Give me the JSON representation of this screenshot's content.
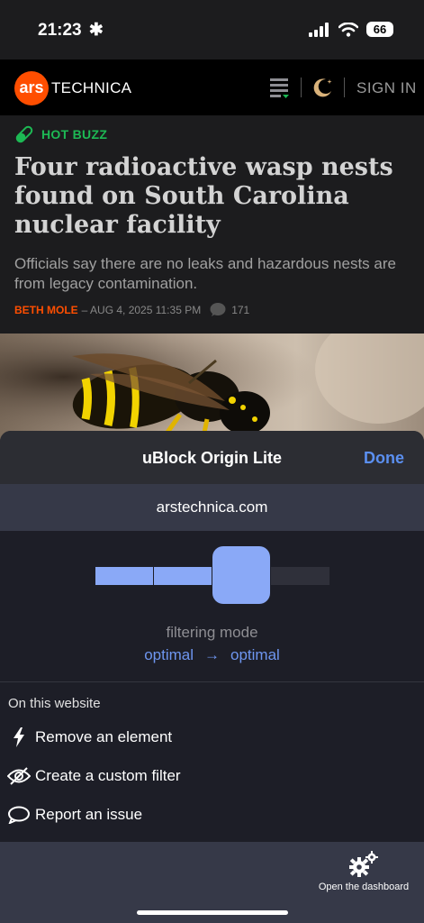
{
  "status": {
    "time": "21:23",
    "battery": "66"
  },
  "header": {
    "logo_short": "ars",
    "logo_word": "TECHNICA",
    "signin": "SIGN IN"
  },
  "article": {
    "category": "HOT BUZZ",
    "headline": "Four radioactive wasp nests found on South Carolina nuclear facility",
    "subtitle": "Officials say there are no leaks and hazardous nests are from legacy contamination.",
    "author": "BETH MOLE",
    "date": "– AUG 4, 2025 11:35 PM",
    "comments": "171"
  },
  "ublock": {
    "title": "uBlock Origin Lite",
    "done": "Done",
    "hostname": "arstechnica.com",
    "filtering_level": 3,
    "filtering_levels": 4,
    "filtering_mode_label": "filtering mode",
    "mode_from": "optimal",
    "mode_arrow": "→",
    "mode_to": "optimal",
    "section_label": "On this website",
    "actions": [
      {
        "label": "Remove an element",
        "icon": "bolt-icon"
      },
      {
        "label": "Create a custom filter",
        "icon": "eye-slash-icon"
      },
      {
        "label": "Report an issue",
        "icon": "speech-bubble-icon"
      }
    ],
    "dashboard_label": "Open the dashboard"
  },
  "colors": {
    "accent": "#5b8ff0",
    "ars_orange": "#ff4e00",
    "hot_buzz_green": "#1db954",
    "slider_fill": "#8aa9f7"
  }
}
